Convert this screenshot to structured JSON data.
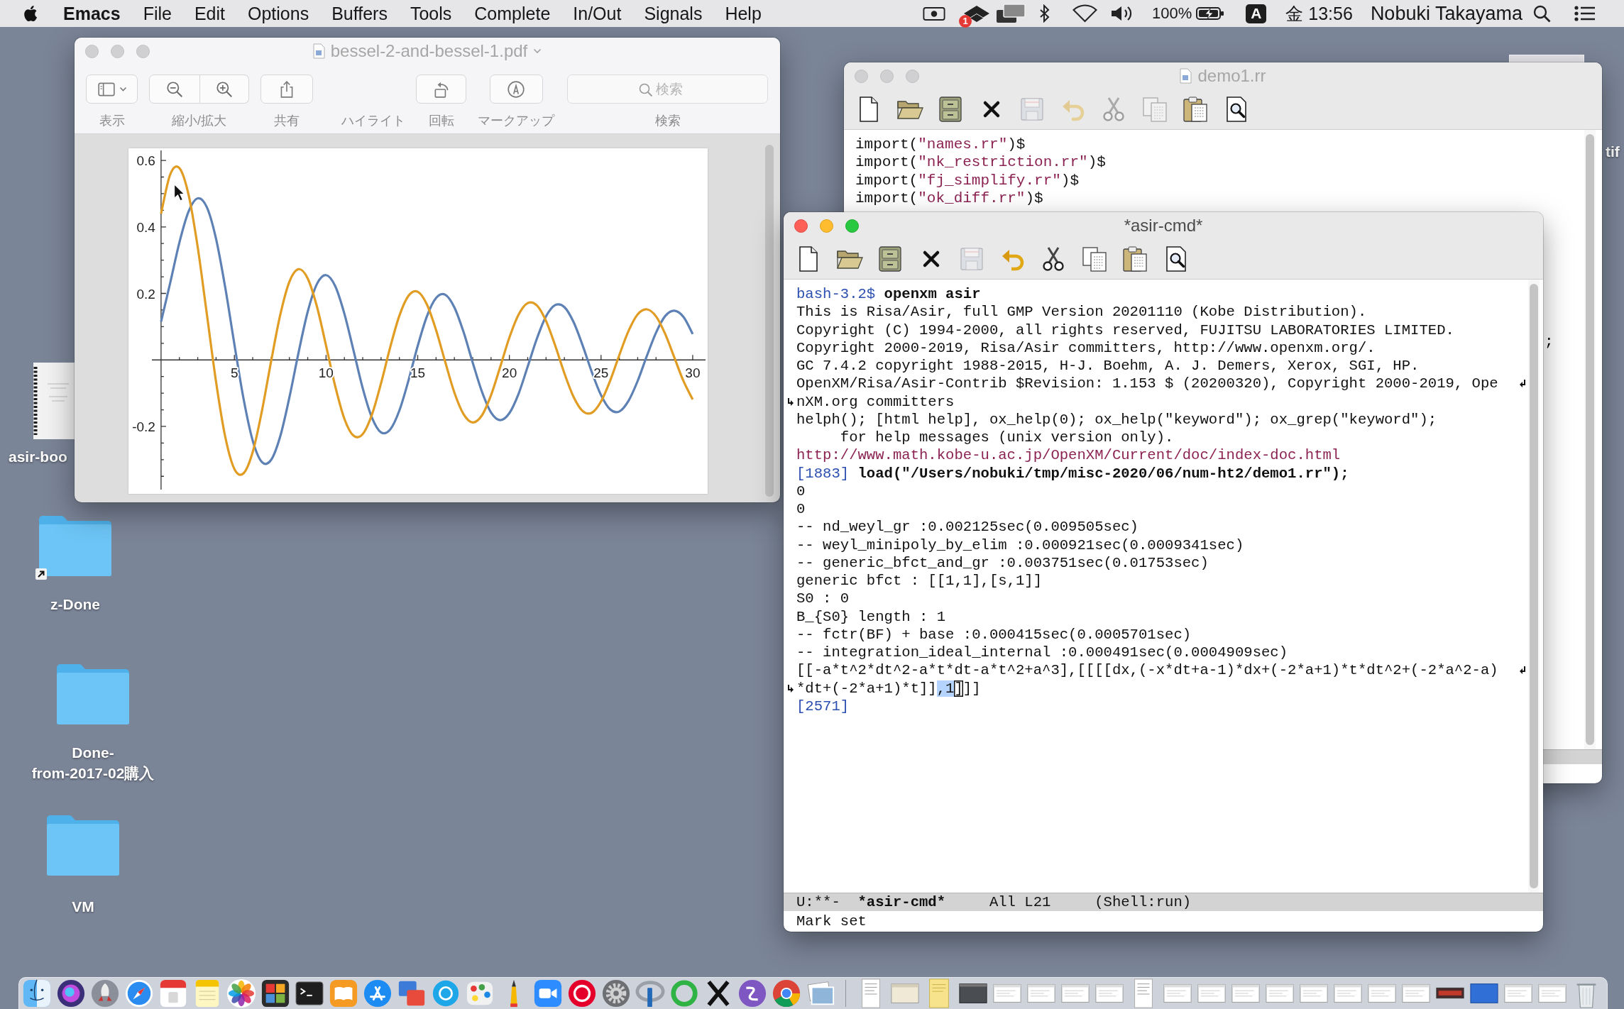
{
  "menu_bar": {
    "app_name": "Emacs",
    "menus": [
      "File",
      "Edit",
      "Options",
      "Buffers",
      "Tools",
      "Complete",
      "In/Out",
      "Signals",
      "Help"
    ],
    "sync_badge": "1",
    "battery_percent": "100%",
    "input_source": "A",
    "clock": "金 13:56",
    "user_name": "Nobuki Takayama"
  },
  "desktop_icons": [
    {
      "kind": "document",
      "alias": false,
      "label_lines": [
        "asir-boo"
      ]
    },
    {
      "kind": "folder",
      "alias": true,
      "label_lines": [
        "z-Done"
      ]
    },
    {
      "kind": "folder",
      "alias": false,
      "label_lines": [
        "Done-",
        "from-2017-02購入"
      ]
    },
    {
      "kind": "folder",
      "alias": false,
      "label_lines": [
        "VM"
      ]
    },
    {
      "kind": "edge",
      "alias": false,
      "label_lines": [
        "tif"
      ]
    }
  ],
  "preview_window": {
    "title": "bessel-2-and-bessel-1.pdf",
    "active": false,
    "file_icon": true,
    "toolbar": [
      {
        "kind": "sidebar",
        "label": "表示"
      },
      {
        "kind": "zoom",
        "label": "縮小/拡大"
      },
      {
        "kind": "share",
        "label": "共有"
      },
      {
        "kind": "label",
        "label": "ハイライト"
      },
      {
        "kind": "rotate",
        "label": "回転"
      },
      {
        "kind": "markup",
        "label": "マークアップ"
      },
      {
        "kind": "search",
        "label": "検索",
        "placeholder": "検索"
      }
    ],
    "chart_data": {
      "type": "line",
      "x": [
        1,
        1.5,
        2,
        2.5,
        3,
        3.5,
        4,
        4.5,
        5,
        5.5,
        6,
        6.5,
        7,
        7.5,
        8,
        8.5,
        9,
        9.5,
        10,
        10.5,
        11,
        11.5,
        12,
        12.5,
        13,
        13.5,
        14,
        14.5,
        15,
        15.5,
        16,
        16.5,
        17,
        17.5,
        18,
        18.5,
        19,
        19.5,
        20,
        20.5,
        21,
        21.5,
        22,
        22.5,
        23,
        23.5,
        24,
        24.5,
        25,
        25.5,
        26,
        26.5,
        27,
        27.5,
        28,
        28.5,
        29,
        29.5,
        30
      ],
      "xlim": [
        0.5,
        30.7
      ],
      "ylim": [
        -0.39,
        0.63
      ],
      "xticks": [
        5,
        10,
        15,
        20,
        25,
        30
      ],
      "yticks": [
        -0.2,
        0.2,
        0.4,
        0.6
      ],
      "series": [
        {
          "color": "#5e81b5",
          "values": [
            0.115,
            0.232,
            0.353,
            0.446,
            0.486,
            0.459,
            0.364,
            0.218,
            0.047,
            -0.117,
            -0.243,
            -0.307,
            -0.301,
            -0.23,
            -0.113,
            0.022,
            0.145,
            0.228,
            0.255,
            0.222,
            0.139,
            0.028,
            -0.085,
            -0.173,
            -0.218,
            -0.209,
            -0.152,
            -0.061,
            0.042,
            0.131,
            0.186,
            0.196,
            0.158,
            0.084,
            -0.008,
            -0.095,
            -0.158,
            -0.181,
            -0.16,
            -0.102,
            -0.02,
            0.064,
            0.131,
            0.165,
            0.159,
            0.114,
            0.043,
            -0.037,
            -0.106,
            -0.149,
            -0.155,
            -0.123,
            -0.063,
            0.012,
            0.082,
            0.132,
            0.148,
            0.129,
            0.078
          ]
        },
        {
          "color": "#e19c24",
          "values": [
            0.44,
            0.558,
            0.577,
            0.497,
            0.339,
            0.137,
            -0.066,
            -0.231,
            -0.328,
            -0.341,
            -0.277,
            -0.154,
            -0.005,
            0.135,
            0.235,
            0.273,
            0.245,
            0.161,
            0.043,
            -0.079,
            -0.177,
            -0.228,
            -0.223,
            -0.165,
            -0.07,
            0.038,
            0.133,
            0.193,
            0.205,
            0.167,
            0.09,
            -0.006,
            -0.098,
            -0.163,
            -0.188,
            -0.167,
            -0.106,
            -0.021,
            0.067,
            0.136,
            0.171,
            0.164,
            0.117,
            0.043,
            -0.04,
            -0.111,
            -0.154,
            -0.159,
            -0.125,
            -0.062,
            0.015,
            0.087,
            0.137,
            0.152,
            0.131,
            0.078,
            0.007,
            -0.064,
            -0.119
          ]
        }
      ]
    }
  },
  "editor_window": {
    "title": "demo1.rr",
    "active": false,
    "file_icon": true,
    "toolbar": [
      {
        "kind": "new",
        "disabled": false
      },
      {
        "kind": "open",
        "disabled": false
      },
      {
        "kind": "dired",
        "disabled": false
      },
      {
        "kind": "kill",
        "disabled": false
      },
      {
        "kind": "save",
        "disabled": true
      },
      {
        "kind": "undo",
        "disabled": true
      },
      {
        "kind": "cut",
        "disabled": true
      },
      {
        "kind": "copy",
        "disabled": true
      },
      {
        "kind": "paste",
        "disabled": false
      },
      {
        "kind": "search",
        "disabled": false
      }
    ],
    "lines": [
      {
        "wraps": false,
        "continued": false,
        "segments": [
          {
            "kind": "plain",
            "text": "import("
          },
          {
            "kind": "string",
            "text": "\"names.rr\""
          },
          {
            "kind": "plain",
            "text": ")$"
          }
        ]
      },
      {
        "wraps": false,
        "continued": false,
        "segments": [
          {
            "kind": "plain",
            "text": "import("
          },
          {
            "kind": "string",
            "text": "\"nk_restriction.rr\""
          },
          {
            "kind": "plain",
            "text": ")$"
          }
        ]
      },
      {
        "wraps": false,
        "continued": false,
        "segments": [
          {
            "kind": "plain",
            "text": "import("
          },
          {
            "kind": "string",
            "text": "\"fj_simplify.rr\""
          },
          {
            "kind": "plain",
            "text": ")$"
          }
        ]
      },
      {
        "wraps": false,
        "continued": false,
        "segments": [
          {
            "kind": "plain",
            "text": "import("
          },
          {
            "kind": "string",
            "text": "\"ok_diff.rr\""
          },
          {
            "kind": "plain",
            "text": ")$"
          }
        ]
      }
    ],
    "covered_line_end": ";"
  },
  "shell_window": {
    "title": "*asir-cmd*",
    "active": true,
    "file_icon": false,
    "toolbar": [
      {
        "kind": "new",
        "disabled": false
      },
      {
        "kind": "open",
        "disabled": false
      },
      {
        "kind": "dired",
        "disabled": false
      },
      {
        "kind": "kill",
        "disabled": false
      },
      {
        "kind": "save",
        "disabled": true
      },
      {
        "kind": "undo",
        "disabled": false
      },
      {
        "kind": "cut",
        "disabled": false
      },
      {
        "kind": "copy",
        "disabled": false
      },
      {
        "kind": "paste",
        "disabled": false
      },
      {
        "kind": "search",
        "disabled": false
      }
    ],
    "lines": [
      {
        "wraps": false,
        "continued": false,
        "segments": [
          {
            "kind": "prompt",
            "text": "bash-3.2$"
          },
          {
            "kind": "input",
            "text": " openxm asir"
          }
        ]
      },
      {
        "wraps": false,
        "continued": false,
        "segments": [
          {
            "kind": "plain",
            "text": "This is Risa/Asir, full GMP Version 20201110 (Kobe Distribution)."
          }
        ]
      },
      {
        "wraps": false,
        "continued": false,
        "segments": [
          {
            "kind": "plain",
            "text": "Copyright (C) 1994-2000, all rights reserved, FUJITSU LABORATORIES LIMITED."
          }
        ]
      },
      {
        "wraps": false,
        "continued": false,
        "segments": [
          {
            "kind": "plain",
            "text": "Copyright 2000-2019, Risa/Asir committers, http://www.openxm.org/."
          }
        ]
      },
      {
        "wraps": false,
        "continued": false,
        "segments": [
          {
            "kind": "plain",
            "text": "GC 7.4.2 copyright 1988-2015, H-J. Boehm, A. J. Demers, Xerox, SGI, HP."
          }
        ]
      },
      {
        "wraps": true,
        "continued": false,
        "segments": [
          {
            "kind": "plain",
            "text": "OpenXM/Risa/Asir-Contrib $Revision: 1.153 $ (20200320), Copyright 2000-2019, Ope"
          }
        ]
      },
      {
        "wraps": false,
        "continued": true,
        "segments": [
          {
            "kind": "plain",
            "text": "nXM.org committers"
          }
        ]
      },
      {
        "wraps": false,
        "continued": false,
        "segments": [
          {
            "kind": "plain",
            "text": "helph(); [html help], ox_help(0); ox_help(\"keyword\"); ox_grep(\"keyword\");"
          }
        ]
      },
      {
        "wraps": false,
        "continued": false,
        "segments": [
          {
            "kind": "plain",
            "text": "     for help messages (unix version only)."
          }
        ]
      },
      {
        "wraps": false,
        "continued": false,
        "segments": [
          {
            "kind": "link",
            "text": "http://www.math.kobe-u.ac.jp/OpenXM/Current/doc/index-doc.html"
          }
        ]
      },
      {
        "wraps": false,
        "continued": false,
        "segments": [
          {
            "kind": "prompt",
            "text": "[1883]"
          },
          {
            "kind": "input",
            "text": " load(\"/Users/nobuki/tmp/misc-2020/06/num-ht2/demo1.rr\");"
          }
        ]
      },
      {
        "wraps": false,
        "continued": false,
        "segments": [
          {
            "kind": "plain",
            "text": "0"
          }
        ]
      },
      {
        "wraps": false,
        "continued": false,
        "segments": [
          {
            "kind": "plain",
            "text": "0"
          }
        ]
      },
      {
        "wraps": false,
        "continued": false,
        "segments": [
          {
            "kind": "plain",
            "text": "-- nd_weyl_gr :0.002125sec(0.009505sec)"
          }
        ]
      },
      {
        "wraps": false,
        "continued": false,
        "segments": [
          {
            "kind": "plain",
            "text": "-- weyl_minipoly_by_elim :0.000921sec(0.0009341sec)"
          }
        ]
      },
      {
        "wraps": false,
        "continued": false,
        "segments": [
          {
            "kind": "plain",
            "text": "-- generic_bfct_and_gr :0.003751sec(0.01753sec)"
          }
        ]
      },
      {
        "wraps": false,
        "continued": false,
        "segments": [
          {
            "kind": "plain",
            "text": "generic bfct : [[1,1],[s,1]]"
          }
        ]
      },
      {
        "wraps": false,
        "continued": false,
        "segments": [
          {
            "kind": "plain",
            "text": "S0 : 0"
          }
        ]
      },
      {
        "wraps": false,
        "continued": false,
        "segments": [
          {
            "kind": "plain",
            "text": "B_{S0} length : 1"
          }
        ]
      },
      {
        "wraps": false,
        "continued": false,
        "segments": [
          {
            "kind": "plain",
            "text": "-- fctr(BF) + base :0.000415sec(0.0005701sec)"
          }
        ]
      },
      {
        "wraps": false,
        "continued": false,
        "segments": [
          {
            "kind": "plain",
            "text": "-- integration_ideal_internal :0.000491sec(0.0004909sec)"
          }
        ]
      },
      {
        "wraps": true,
        "continued": false,
        "segments": [
          {
            "kind": "plain",
            "text": "[[-a*t^2*dt^2-a*t*dt-a*t^2+a^3],[[[[dx,(-x*dt+a-1)*dx+(-2*a+1)*t*dt^2+(-2*a^2-a)"
          }
        ]
      },
      {
        "wraps": false,
        "continued": true,
        "segments": [
          {
            "kind": "plain",
            "text": "*dt+(-2*a+1)*t]]"
          },
          {
            "kind": "region",
            "text": ",1"
          },
          {
            "kind": "cursor",
            "text": "]"
          },
          {
            "kind": "plain",
            "text": "]]"
          }
        ]
      },
      {
        "wraps": false,
        "continued": false,
        "segments": [
          {
            "kind": "prompt",
            "text": "[2571]"
          }
        ]
      }
    ],
    "mode_line": {
      "status": "U:**-",
      "buffer": "*asir-cmd*",
      "position": "All L21",
      "mode": "(Shell:run)"
    },
    "echo_area": "Mark set"
  },
  "dock": {
    "apps": [
      {
        "kind": "finder"
      },
      {
        "kind": "siri"
      },
      {
        "kind": "rocket"
      },
      {
        "kind": "compass"
      },
      {
        "kind": "calendar"
      },
      {
        "kind": "notes"
      },
      {
        "kind": "flower"
      },
      {
        "kind": "grid"
      },
      {
        "kind": "terminal"
      },
      {
        "kind": "book"
      },
      {
        "kind": "store"
      },
      {
        "kind": "screens"
      },
      {
        "kind": "bubble"
      },
      {
        "kind": "palette"
      },
      {
        "kind": "pencil"
      },
      {
        "kind": "camera"
      },
      {
        "kind": "disc"
      },
      {
        "kind": "gear"
      },
      {
        "kind": "ellipse"
      },
      {
        "kind": "ring"
      },
      {
        "kind": "cross"
      },
      {
        "kind": "swirl"
      },
      {
        "kind": "wheel"
      },
      {
        "kind": "photos"
      }
    ],
    "windows": [
      {
        "kind": "page"
      },
      {
        "kind": "beige"
      },
      {
        "kind": "note"
      },
      {
        "kind": "dark"
      },
      {
        "kind": "window"
      },
      {
        "kind": "window"
      },
      {
        "kind": "window"
      },
      {
        "kind": "window"
      },
      {
        "kind": "page"
      },
      {
        "kind": "window"
      },
      {
        "kind": "window"
      },
      {
        "kind": "window"
      },
      {
        "kind": "window"
      },
      {
        "kind": "window"
      },
      {
        "kind": "window"
      },
      {
        "kind": "window"
      },
      {
        "kind": "window"
      },
      {
        "kind": "strip"
      },
      {
        "kind": "blue"
      },
      {
        "kind": "window"
      },
      {
        "kind": "window"
      }
    ]
  }
}
